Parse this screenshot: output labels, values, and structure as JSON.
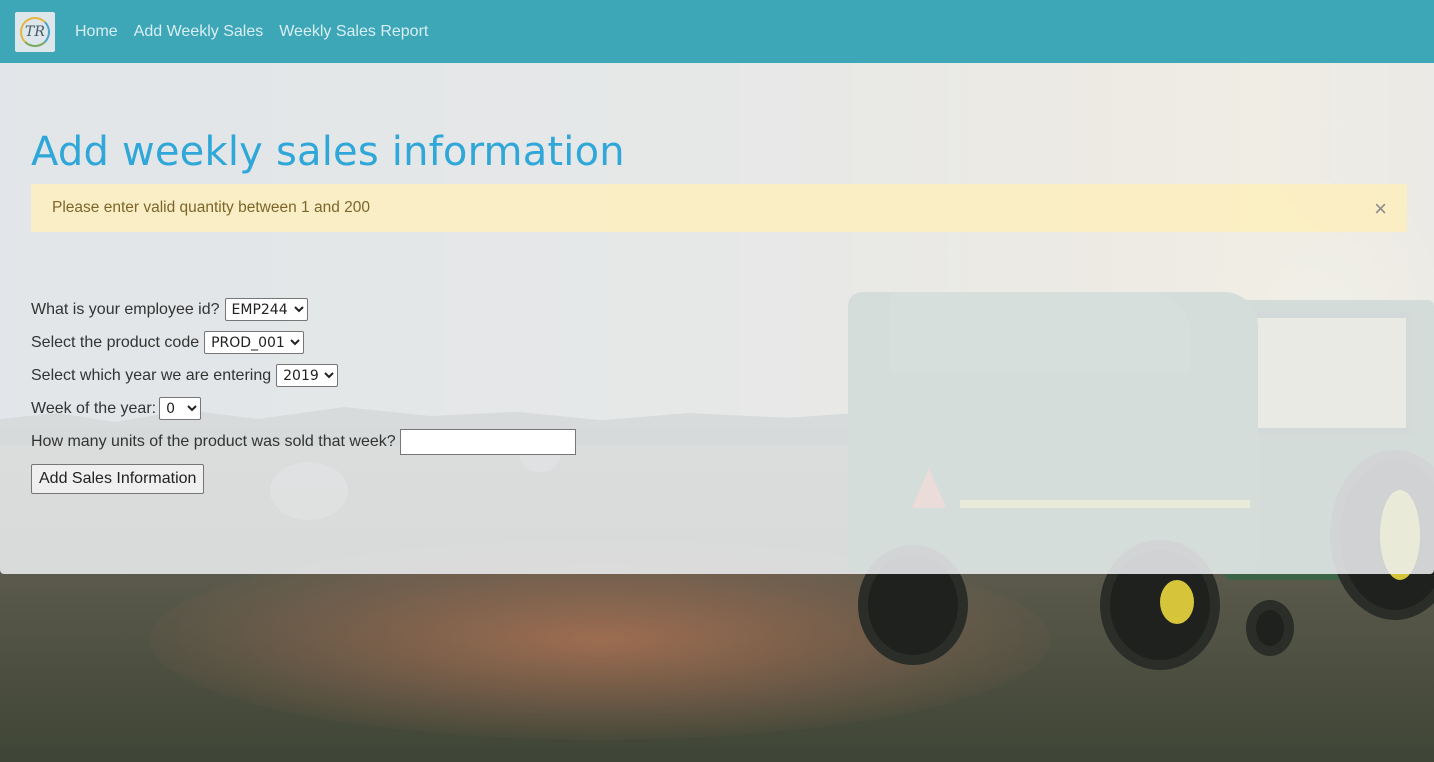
{
  "navbar": {
    "logo_text": "TR",
    "links": [
      "Home",
      "Add Weekly Sales",
      "Weekly Sales Report"
    ]
  },
  "page": {
    "title": "Add weekly sales information"
  },
  "alert": {
    "message": "Please enter valid quantity between 1 and 200",
    "close_glyph": "×"
  },
  "form": {
    "employee_label": "What is your employee id?",
    "employee_value": "EMP244",
    "product_label": "Select the product code",
    "product_value": "PROD_001",
    "year_label": "Select which year we are entering",
    "year_value": "2019",
    "week_label": "Week of the year:",
    "week_value": "0",
    "units_label": "How many units of the product was sold that week?",
    "units_value": "",
    "submit_label": "Add Sales Information"
  },
  "colors": {
    "navbar": "#3da7b8",
    "title": "#2fa7d8",
    "alert_bg": "#fdeebe",
    "alert_text": "#7d6629"
  }
}
